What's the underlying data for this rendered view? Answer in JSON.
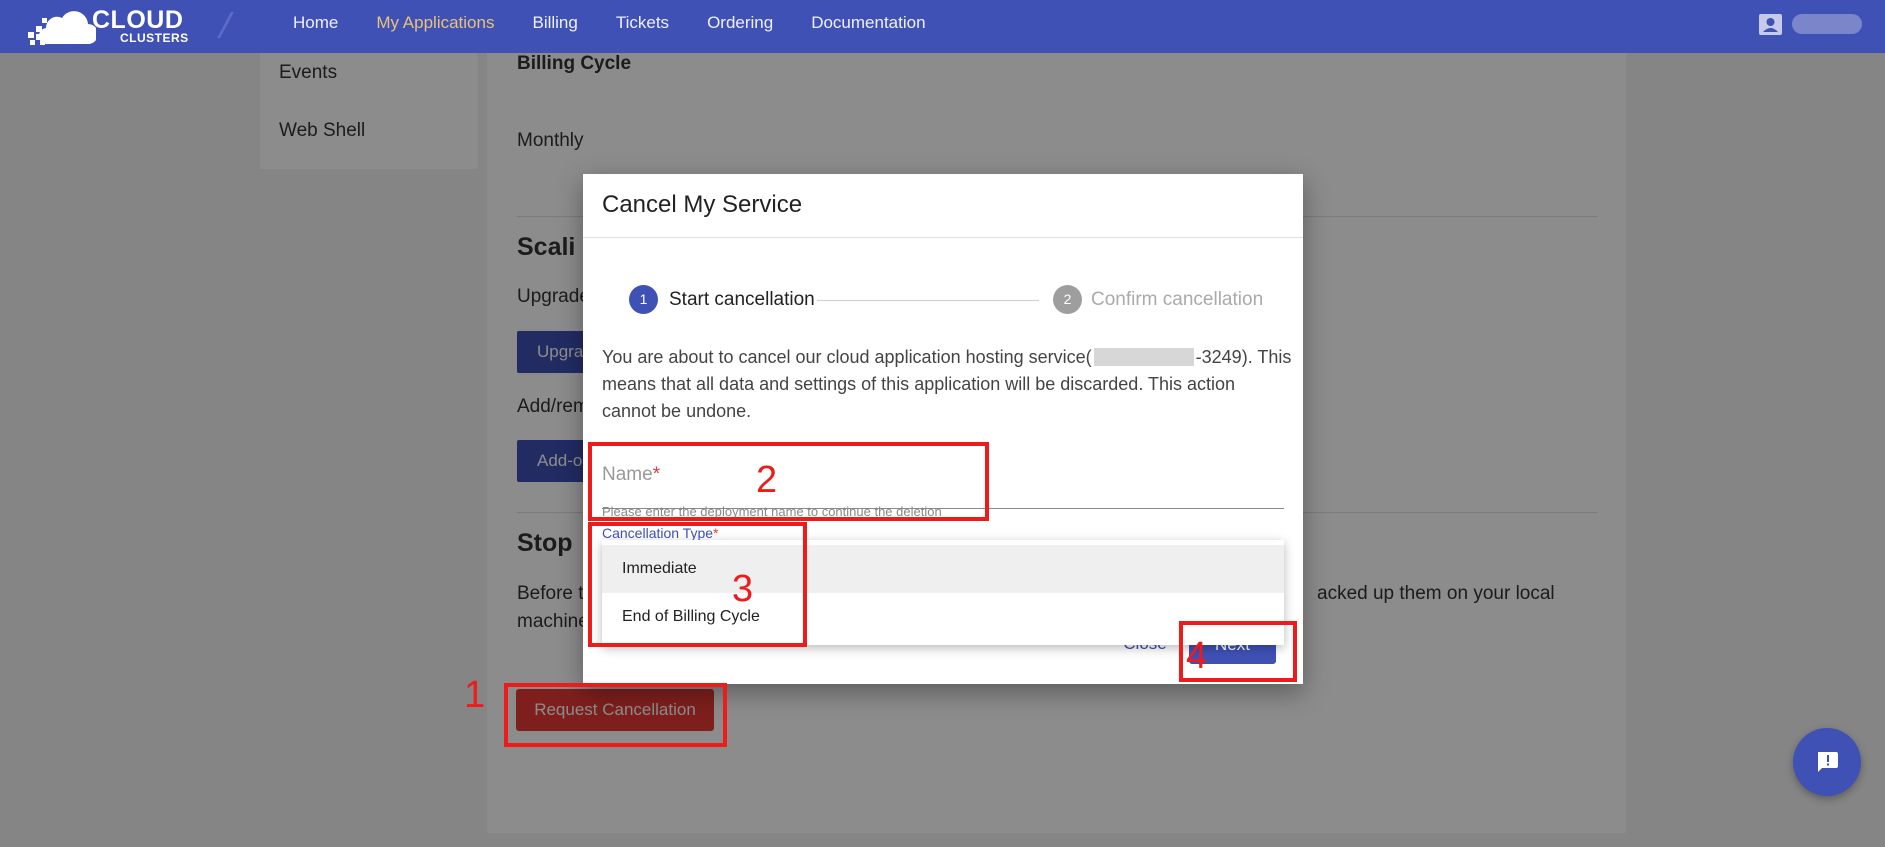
{
  "header": {
    "logo_top": "CLOUD",
    "logo_bottom": "CLUSTERS",
    "nav": [
      {
        "label": "Home",
        "active": false
      },
      {
        "label": "My Applications",
        "active": true
      },
      {
        "label": "Billing",
        "active": false
      },
      {
        "label": "Tickets",
        "active": false
      },
      {
        "label": "Ordering",
        "active": false
      },
      {
        "label": "Documentation",
        "active": false
      }
    ]
  },
  "sidebar": {
    "items": [
      "Events",
      "Web Shell"
    ]
  },
  "page": {
    "billing_cycle_title": "Billing Cycle",
    "billing_cycle_value": "Monthly",
    "scaling_title": "Scali",
    "upgrade_text": "Upgrade",
    "upgrade_button": "Upgra",
    "addremove_text": "Add/rem",
    "addon_button": "Add-o",
    "stop_title": "Stop",
    "stop_text_left_1": "Before t",
    "stop_text_left_2": "machine",
    "stop_text_right": "acked up them on your local",
    "request_cancellation_button": "Request Cancellation"
  },
  "modal": {
    "title": "Cancel My Service",
    "steps": [
      {
        "number": "1",
        "label": "Start cancellation",
        "active": true
      },
      {
        "number": "2",
        "label": "Confirm cancellation",
        "active": false
      }
    ],
    "message_before": "You are about to cancel our cloud application hosting service(",
    "message_id_suffix": "-3249).",
    "message_after": "This means that all data and settings of this application will be discarded. This action cannot be undone.",
    "name_field": {
      "label": "Name",
      "required_mark": "*",
      "value": "",
      "hint": "Please enter the deployment name to continue the deletion"
    },
    "cancellation_type": {
      "label": "Cancellation Type",
      "required_mark": "*",
      "options": [
        "Immediate",
        "End of Billing Cycle"
      ],
      "highlighted": "Immediate"
    },
    "close_button": "Close",
    "next_button": "Next"
  },
  "annotations": [
    "1",
    "2",
    "3",
    "4"
  ],
  "colors": {
    "primary": "#3f51b5",
    "nav_active": "#e6c27a",
    "danger": "#e53935",
    "annotation": "#ee1b1b"
  }
}
